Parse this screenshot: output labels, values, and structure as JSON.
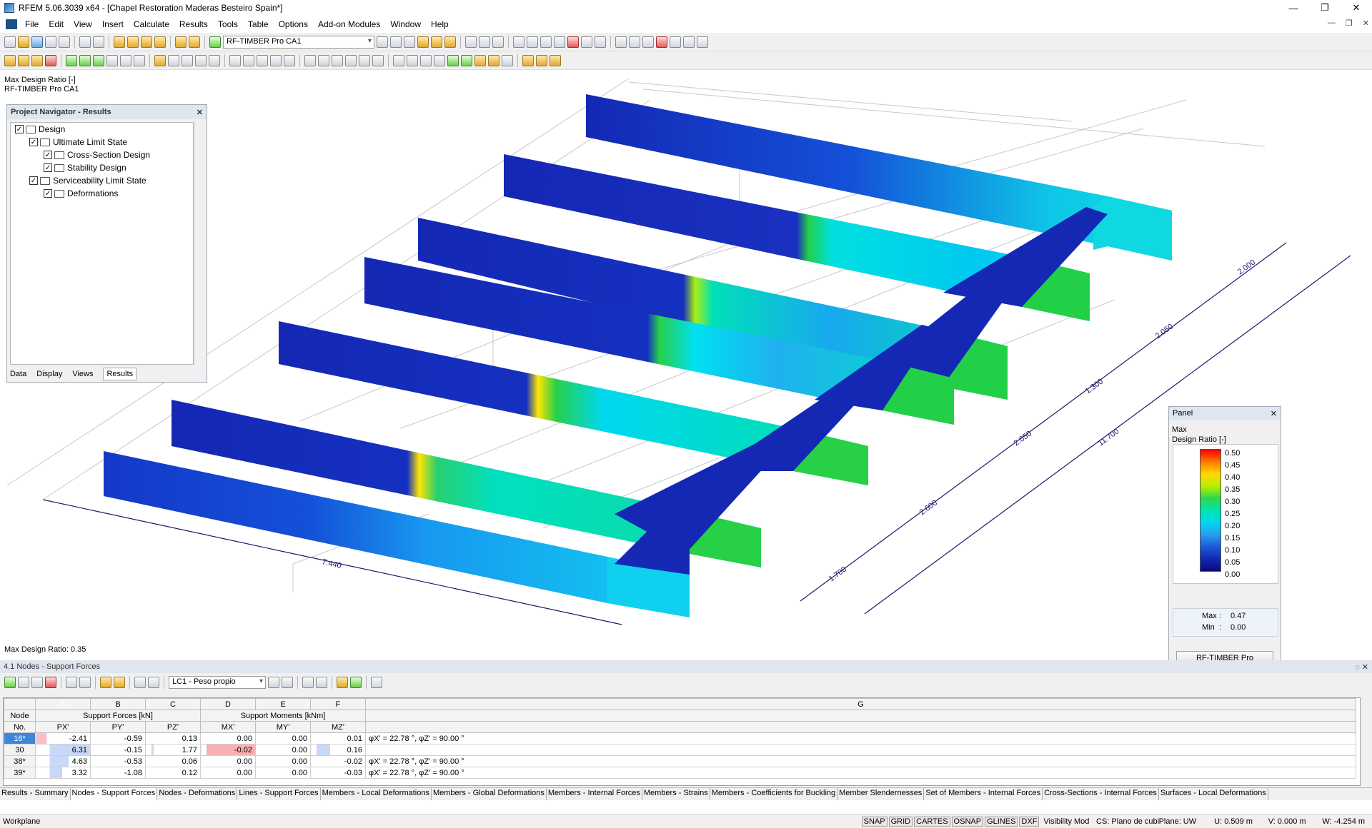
{
  "app": {
    "title": "RFEM 5.06.3039 x64 - [Chapel Restoration Maderas Besteiro Spain*]"
  },
  "menu": [
    "File",
    "Edit",
    "View",
    "Insert",
    "Calculate",
    "Results",
    "Tools",
    "Table",
    "Options",
    "Add-on Modules",
    "Window",
    "Help"
  ],
  "toolbar": {
    "case_combo": "RF-TIMBER Pro CA1"
  },
  "viewport": {
    "info_line1": "Max Design Ratio [-]",
    "info_line2": "RF-TIMBER Pro CA1",
    "footer": "Max Design Ratio: 0.35",
    "dimensions": [
      "2.000",
      "2.050",
      "1.300",
      "2.050",
      "2.600",
      "1.700",
      "11.700",
      "7.440"
    ]
  },
  "navigator": {
    "title": "Project Navigator - Results",
    "items": [
      {
        "label": "Design",
        "checked": true
      },
      {
        "label": "Ultimate Limit State",
        "checked": true
      },
      {
        "label": "Cross-Section Design",
        "checked": true
      },
      {
        "label": "Stability Design",
        "checked": true
      },
      {
        "label": "Serviceability Limit State",
        "checked": true
      },
      {
        "label": "Deformations",
        "checked": true
      }
    ],
    "tabs": [
      "Data",
      "Display",
      "Views",
      "Results"
    ],
    "active_tab": "Results"
  },
  "panel": {
    "title": "Panel",
    "heading1": "Max",
    "heading2": "Design Ratio [-]",
    "legend_values": [
      "0.50",
      "0.45",
      "0.40",
      "0.35",
      "0.30",
      "0.25",
      "0.20",
      "0.15",
      "0.10",
      "0.05",
      "0.00"
    ],
    "max_label": "Max",
    "max_value": "0.47",
    "min_label": "Min",
    "min_value": "0.00",
    "button": "RF-TIMBER Pro"
  },
  "table": {
    "title": "4.1 Nodes - Support Forces",
    "combo": "LC1 - Peso propio",
    "col_letters": [
      "A",
      "B",
      "C",
      "D",
      "E",
      "F",
      "G"
    ],
    "group_forces": "Support Forces [kN]",
    "group_moments": "Support Moments [kNm]",
    "node_header1": "Node",
    "node_header2": "No.",
    "sub_headers": [
      "PX'",
      "PY'",
      "PZ'",
      "MX'",
      "MY'",
      "MZ'"
    ],
    "rows": [
      {
        "node": "16*",
        "px": "-2.41",
        "py": "-0.59",
        "pz": "0.13",
        "mx": "0.00",
        "my": "0.00",
        "mz": "0.01",
        "note": "φX' = 22.78 °, φZ' = 90.00 °"
      },
      {
        "node": "30",
        "px": "6.31",
        "py": "-0.15",
        "pz": "1.77",
        "mx": "-0.02",
        "my": "0.00",
        "mz": "0.16",
        "note": ""
      },
      {
        "node": "38*",
        "px": "4.63",
        "py": "-0.53",
        "pz": "0.06",
        "mx": "0.00",
        "my": "0.00",
        "mz": "-0.02",
        "note": "φX' = 22.78 °, φZ' = 90.00 °"
      },
      {
        "node": "39*",
        "px": "3.32",
        "py": "-1.08",
        "pz": "0.12",
        "mx": "0.00",
        "my": "0.00",
        "mz": "-0.03",
        "note": "φX' = 22.78 °, φZ' = 90.00 °"
      }
    ]
  },
  "bottom_tabs": [
    "Results - Summary",
    "Nodes - Support Forces",
    "Nodes - Deformations",
    "Lines - Support Forces",
    "Members - Local Deformations",
    "Members - Global Deformations",
    "Members - Internal Forces",
    "Members - Strains",
    "Members - Coefficients for Buckling",
    "Member Slendernesses",
    "Set of Members - Internal Forces",
    "Cross-Sections - Internal Forces",
    "Surfaces - Local Deformations"
  ],
  "active_bottom_tab": "Nodes - Support Forces",
  "status": {
    "left": "Workplane",
    "toggles": [
      "SNAP",
      "GRID",
      "CARTES",
      "OSNAP",
      "GLINES",
      "DXF"
    ],
    "visibility": "Visibility Mod",
    "cs": "CS: Plano de cubi",
    "plane": "Plane: UW",
    "u": "U:  0.509 m",
    "v": "V:  0.000 m",
    "w": "W:  -4.254 m"
  },
  "colors": {
    "accent": "#3c87d8",
    "deep_blue": "#1428b4",
    "cyan": "#00d8f0",
    "green": "#2fd650",
    "yellow": "#ffd800"
  }
}
